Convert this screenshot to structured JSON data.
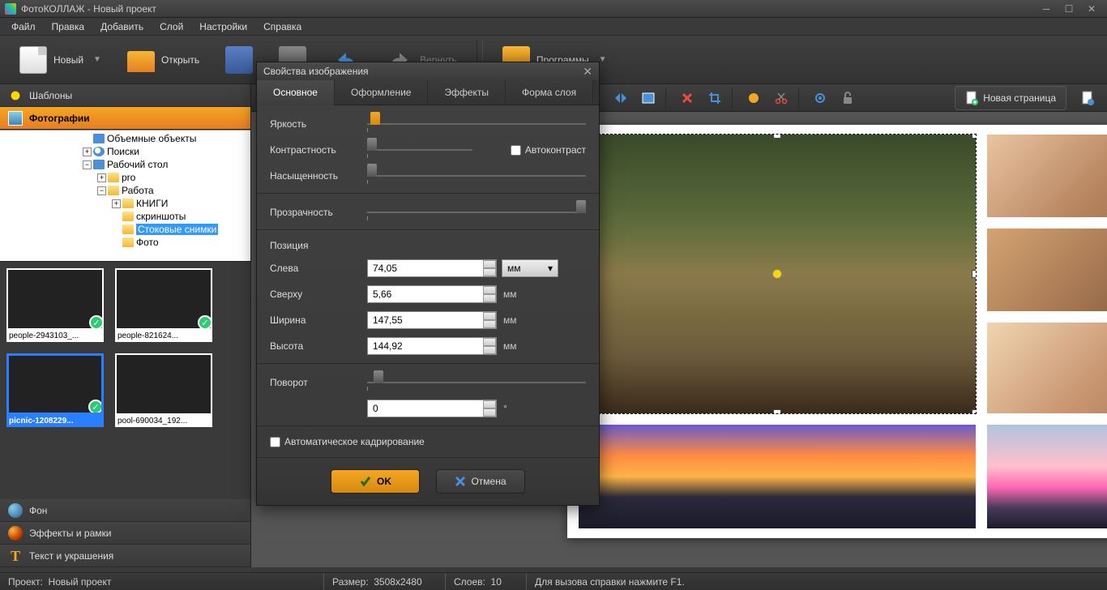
{
  "titlebar": {
    "title": "ФотоКОЛЛАЖ - Новый проект"
  },
  "menu": {
    "file": "Файл",
    "edit": "Правка",
    "add": "Добавить",
    "layer": "Слой",
    "settings": "Настройки",
    "help": "Справка"
  },
  "toolbar": {
    "new": "Новый",
    "open": "Открыть",
    "return": "Вернуть",
    "programs": "Программы"
  },
  "sidetabs": {
    "templates": "Шаблоны",
    "photos": "Фотографии",
    "background": "Фон",
    "effects": "Эффекты и рамки",
    "text": "Текст и украшения"
  },
  "tree": {
    "n1": "Объемные объекты",
    "n2": "Поиски",
    "n3": "Рабочий стол",
    "n4": "pro",
    "n5": "Работа",
    "n6": "КНИГИ",
    "n7": "скриншоты",
    "n8": "Стоковые снимки",
    "n9": "Фото"
  },
  "thumbs": {
    "t1": "people-2943103_...",
    "t2": "people-821624...",
    "t3": "picnic-1208229...",
    "t4": "pool-690034_192..."
  },
  "canvastools": {
    "newpage": "Новая страница"
  },
  "dialog": {
    "title": "Свойства изображения",
    "tabs": {
      "main": "Основное",
      "design": "Оформление",
      "effects": "Эффекты",
      "shape": "Форма слоя"
    },
    "brightness": "Яркость",
    "contrast": "Контрастность",
    "autocontrast": "Автоконтраст",
    "saturation": "Насыщенность",
    "transparency": "Прозрачность",
    "position": "Позиция",
    "left": "Слева",
    "left_v": "74,05",
    "top": "Сверху",
    "top_v": "5,66",
    "width": "Ширина",
    "width_v": "147,55",
    "height": "Высота",
    "height_v": "144,92",
    "unit": "мм",
    "rotation": "Поворот",
    "rotation_v": "0",
    "deg": "°",
    "autocrop": "Автоматическое кадрирование",
    "ok": "OK",
    "cancel": "Отмена"
  },
  "status": {
    "project_l": "Проект:",
    "project_v": "Новый проект",
    "size_l": "Размер:",
    "size_v": "3508x2480",
    "layers_l": "Слоев:",
    "layers_v": "10",
    "hint": "Для вызова справки нажмите F1."
  }
}
